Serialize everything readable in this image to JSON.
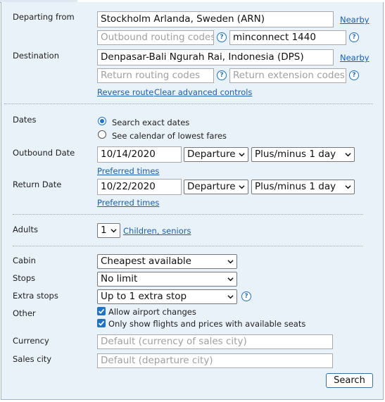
{
  "route": {
    "departing_label": "Departing from",
    "departing_value": "Stockholm Arlanda, Sweden (ARN)",
    "nearby_link": "Nearby",
    "outbound_routing_placeholder": "Outbound routing codes",
    "outbound_extension_value": "minconnect 1440",
    "destination_label": "Destination",
    "destination_value": "Denpasar-Bali Ngurah Rai, Indonesia (DPS)",
    "nearby_link_2": "Nearby",
    "return_routing_placeholder": "Return routing codes",
    "return_extension_placeholder": "Return extension codes",
    "reverse_route_link": "Reverse route",
    "clear_advanced_link": "Clear advanced controls",
    "help_symbol": "?"
  },
  "dates": {
    "label": "Dates",
    "option_exact": "Search exact dates",
    "option_calendar": "See calendar of lowest fares",
    "selected": "exact",
    "outbound_label": "Outbound Date",
    "outbound_date": "10/14/2020",
    "outbound_time_type": "Departure",
    "outbound_flex": "Plus/minus 1 day",
    "outbound_preferred": "Preferred times",
    "return_label": "Return Date",
    "return_date": "10/22/2020",
    "return_time_type": "Departure",
    "return_flex": "Plus/minus 1 day",
    "return_preferred": "Preferred times"
  },
  "passengers": {
    "adults_label": "Adults",
    "adults_value": "1",
    "children_link": "Children, seniors"
  },
  "options": {
    "cabin_label": "Cabin",
    "cabin_value": "Cheapest available",
    "stops_label": "Stops",
    "stops_value": "No limit",
    "extra_stops_label": "Extra stops",
    "extra_stops_value": "Up to 1 extra stop",
    "other_label": "Other",
    "allow_airport_changes": "Allow airport changes",
    "allow_airport_changes_checked": true,
    "only_available_seats": "Only show flights and prices with available seats",
    "only_available_seats_checked": true,
    "currency_label": "Currency",
    "currency_placeholder": "Default (currency of sales city)",
    "sales_city_label": "Sales city",
    "sales_city_placeholder": "Default (departure city)",
    "search_button": "Search"
  },
  "icons": {
    "help": "help-circle-icon",
    "dropdown": "chevron-down-icon",
    "checkbox": "checkmark-icon",
    "radio": "radio-dot-icon"
  },
  "colors": {
    "panel_bg": "#e9f1f9",
    "accent": "#1e72c8",
    "link": "#1a5fb4",
    "border": "#9bb4cc"
  }
}
